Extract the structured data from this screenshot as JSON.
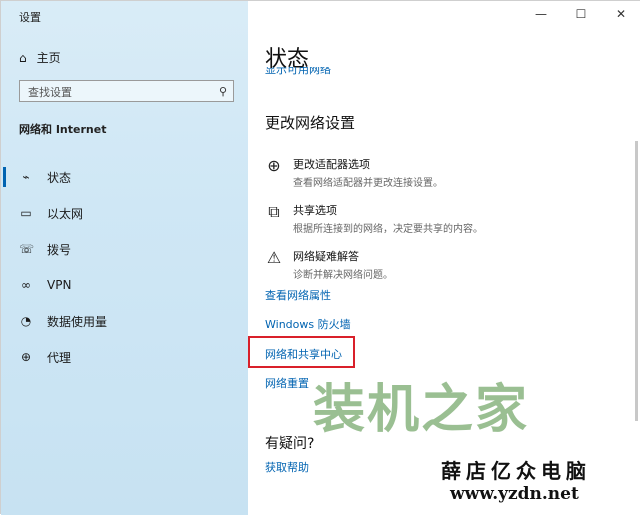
{
  "app": {
    "title": "设置"
  },
  "window_controls": {
    "minimize": "—",
    "maximize": "☐",
    "close": "✕"
  },
  "sidebar": {
    "home": {
      "icon": "home-icon",
      "label": "主页"
    },
    "search": {
      "placeholder": "查找设置"
    },
    "section_title": "网络和 Internet",
    "items": [
      {
        "icon": "status-icon",
        "label": "状态"
      },
      {
        "icon": "ethernet-icon",
        "label": "以太网"
      },
      {
        "icon": "dialup-icon",
        "label": "拨号"
      },
      {
        "icon": "vpn-icon",
        "label": "VPN"
      },
      {
        "icon": "data-usage-icon",
        "label": "数据使用量"
      },
      {
        "icon": "proxy-icon",
        "label": "代理"
      }
    ]
  },
  "main": {
    "title": "状态",
    "cut_link": "显示可用网络",
    "change_heading": "更改网络设置",
    "settings": [
      {
        "icon": "adapter-icon",
        "title": "更改适配器选项",
        "desc": "查看网络适配器并更改连接设置。"
      },
      {
        "icon": "sharing-icon",
        "title": "共享选项",
        "desc": "根据所连接到的网络，决定要共享的内容。"
      },
      {
        "icon": "warning-icon",
        "title": "网络疑难解答",
        "desc": "诊断并解决网络问题。"
      }
    ],
    "links": [
      "查看网络属性",
      "Windows 防火墙",
      "网络和共享中心",
      "网络重置"
    ],
    "help_heading": "有疑问?",
    "help_link": "获取帮助"
  },
  "watermark": {
    "main": "装机之家",
    "store": "薛店亿众电脑",
    "url": "www.yzdn.net"
  },
  "colors": {
    "accent": "#0063b1",
    "highlight": "#d9202a",
    "sidebar_bg": "#cfe7f5"
  }
}
